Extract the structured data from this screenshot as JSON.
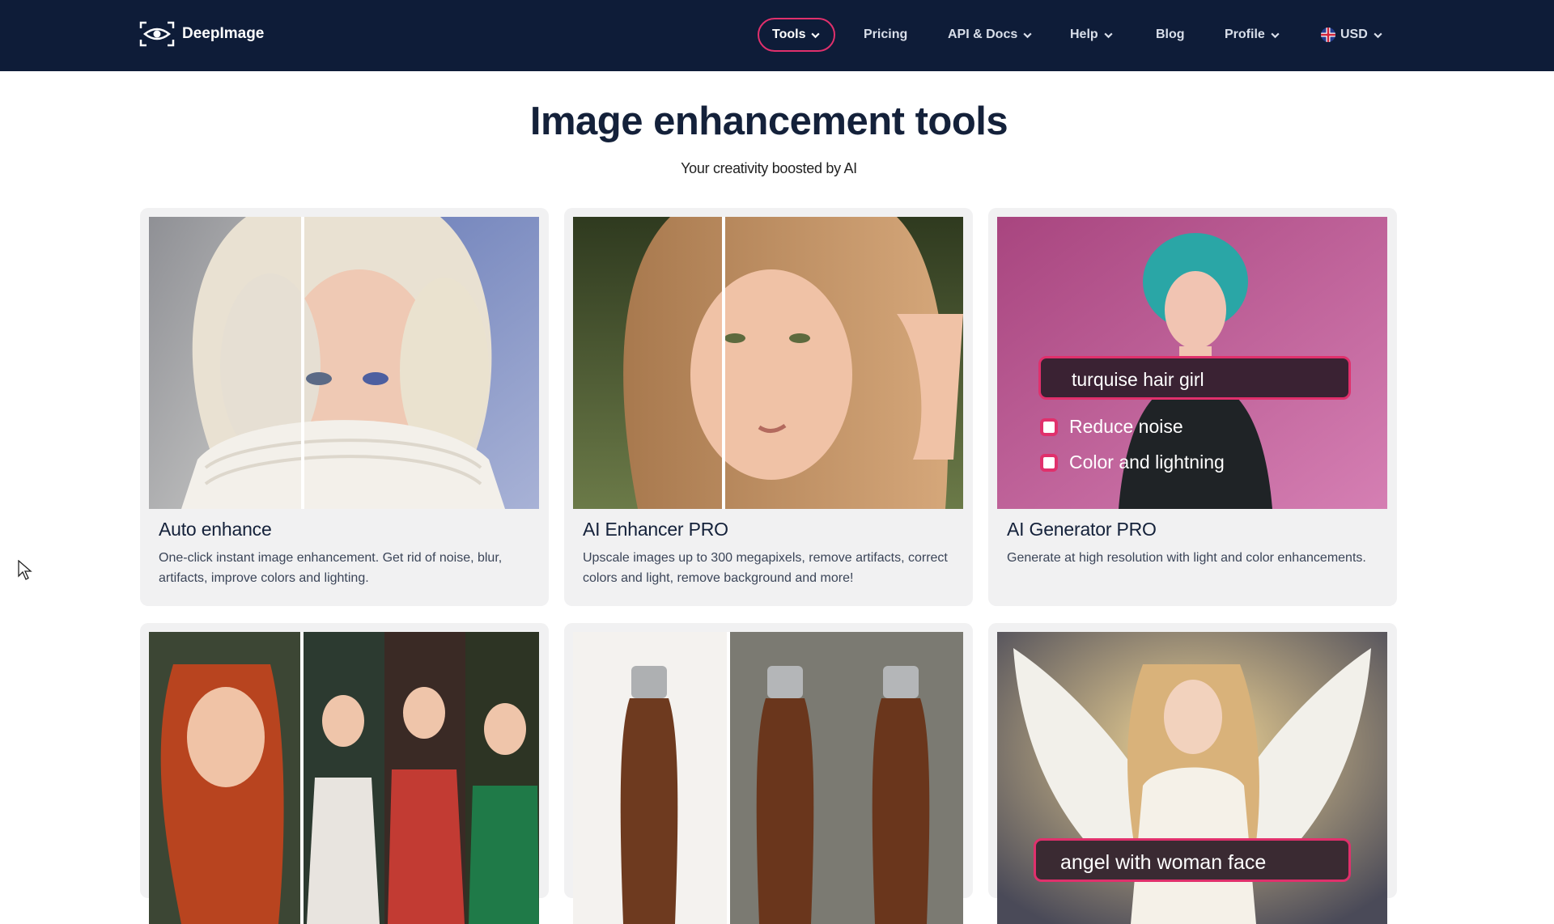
{
  "nav": {
    "logo_text": "DeepImage",
    "items": [
      {
        "label": "Tools"
      },
      {
        "label": "Pricing"
      },
      {
        "label": "API & Docs"
      },
      {
        "label": "Help"
      },
      {
        "label": "Blog"
      },
      {
        "label": "Profile"
      },
      {
        "label": "USD"
      }
    ]
  },
  "hero": {
    "title": "Image enhancement tools",
    "subtitle": "Your creativity boosted by AI"
  },
  "cards": [
    {
      "title": "Auto enhance",
      "description": "One-click instant image enhancement. Get rid of noise, blur, artifacts, improve colors and lighting."
    },
    {
      "title": "AI Enhancer PRO",
      "description": "Upscale images up to 300 megapixels, remove artifacts, correct colors and light, remove background and more!"
    },
    {
      "title": "AI Generator PRO",
      "description": "Generate at high resolution with light and color enhancements.",
      "overlay": {
        "prompt": "turquise hair girl",
        "options": [
          "Reduce noise",
          "Color and lightning"
        ]
      }
    },
    {
      "title": "",
      "description": ""
    },
    {
      "title": "",
      "description": ""
    },
    {
      "title": "",
      "description": "",
      "overlay": {
        "prompt": "angel with woman face"
      }
    }
  ],
  "colors": {
    "nav_bg": "#0e1c38",
    "accent": "#e0306c",
    "card_bg": "#f1f1f2"
  }
}
